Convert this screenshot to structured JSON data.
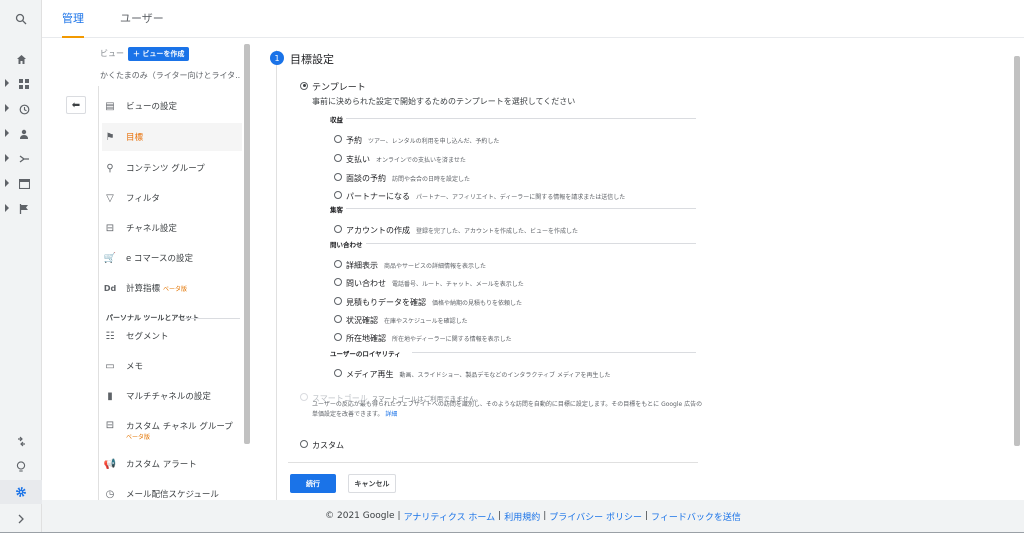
{
  "tabs": {
    "admin": "管理",
    "user": "ユーザー"
  },
  "admin": {
    "view_label": "ビュー",
    "create_view_button": "＋ ビューを作成",
    "view_selector": "かくたまのみ（ライター向けとライタ..",
    "menu": [
      {
        "icon": "file-icon",
        "glyph": "▤",
        "label": "ビューの設定"
      },
      {
        "icon": "flag-icon",
        "glyph": "⚑",
        "label": "目標"
      },
      {
        "icon": "content-group-icon",
        "glyph": "⚲",
        "label": "コンテンツ グループ"
      },
      {
        "icon": "filter-icon",
        "glyph": "▽",
        "label": "フィルタ"
      },
      {
        "icon": "channel-icon",
        "glyph": "⊟",
        "label": "チャネル設定"
      },
      {
        "icon": "cart-icon",
        "glyph": "🛒",
        "label": "e コマースの設定"
      },
      {
        "icon": "dd-icon",
        "glyph": "Dd",
        "label": "計算指標",
        "badge": "ベータ版"
      }
    ],
    "personal_tools_label": "パーソナル ツールとアセット",
    "personal_menu": [
      {
        "icon": "segment-icon",
        "glyph": "☷",
        "label": "セグメント"
      },
      {
        "icon": "memo-icon",
        "glyph": "▭",
        "label": "メモ"
      },
      {
        "icon": "bar-chart-icon",
        "glyph": "▮",
        "label": "マルチチャネルの設定"
      },
      {
        "icon": "custom-channel-icon",
        "glyph": "⊟",
        "label": "カスタム チャネル グループ",
        "badge": "ベータ版"
      },
      {
        "icon": "megaphone-icon",
        "glyph": "📢",
        "label": "カスタム アラート"
      },
      {
        "icon": "schedule-icon",
        "glyph": "◷",
        "label": "メール配信スケジュール"
      }
    ]
  },
  "goal": {
    "step_number": "1",
    "title": "目標設定",
    "template_label": "テンプレート",
    "template_intro": "事前に決められた設定で開始するためのテンプレートを選択してください",
    "categories": [
      {
        "name": "収益",
        "options": [
          {
            "label": "予約",
            "desc": "ツアー、レンタルの利用を申し込んだ、予約した"
          },
          {
            "label": "支払い",
            "desc": "オンラインでの支払いを済ませた"
          },
          {
            "label": "面談の予約",
            "desc": "訪問や会合の日時を設定した"
          },
          {
            "label": "パートナーになる",
            "desc": "パートナー、アフィリエイト、ディーラーに関する情報を請求または送信した"
          }
        ]
      },
      {
        "name": "集客",
        "options": [
          {
            "label": "アカウントの作成",
            "desc": "登録を完了した、アカウントを作成した、ビューを作成した"
          }
        ]
      },
      {
        "name": "問い合わせ",
        "options": [
          {
            "label": "詳細表示",
            "desc": "商品やサービスの詳細情報を表示した"
          },
          {
            "label": "問い合わせ",
            "desc": "電話番号、ルート、チャット、メールを表示した"
          },
          {
            "label": "見積もりデータを確認",
            "desc": "価格や納期の見積もりを依頼した"
          },
          {
            "label": "状況確認",
            "desc": "在庫やスケジュールを確認した"
          },
          {
            "label": "所在地確認",
            "desc": "所在地やディーラーに関する情報を表示した"
          }
        ]
      },
      {
        "name": "ユーザーのロイヤリティ",
        "options": [
          {
            "label": "メディア再生",
            "desc": "動画、スライドショー、製品デモなどのインタラクティブ メディアを再生した"
          }
        ]
      }
    ],
    "smart_goal_label": "スマートゴール",
    "smart_goal_desc": "スマートゴールはご利用できません。",
    "smart_goal_help": "ユーザーの反応が最も得られたウェブサイトへの訪問を識別し、そのような訪問を自動的に目標に設定します。その目標をもとに Google 広告の単価設定を改善できます。",
    "smart_goal_link": "詳細",
    "custom_label": "カスタム",
    "continue_button": "続行",
    "cancel_button": "キャンセル"
  },
  "footer": {
    "copyright": "© 2021 Google",
    "links": [
      "アナリティクス ホーム",
      "利用規約",
      "プライバシー ポリシー",
      "フィードバックを送信"
    ]
  },
  "rail": [
    "search-icon",
    "home-icon",
    "dashboard-icon",
    "clock-icon",
    "person-icon",
    "acquisition-icon",
    "behavior-icon",
    "flag-icon",
    "share-icon",
    "lightbulb-icon",
    "gear-icon",
    "expand-icon"
  ]
}
